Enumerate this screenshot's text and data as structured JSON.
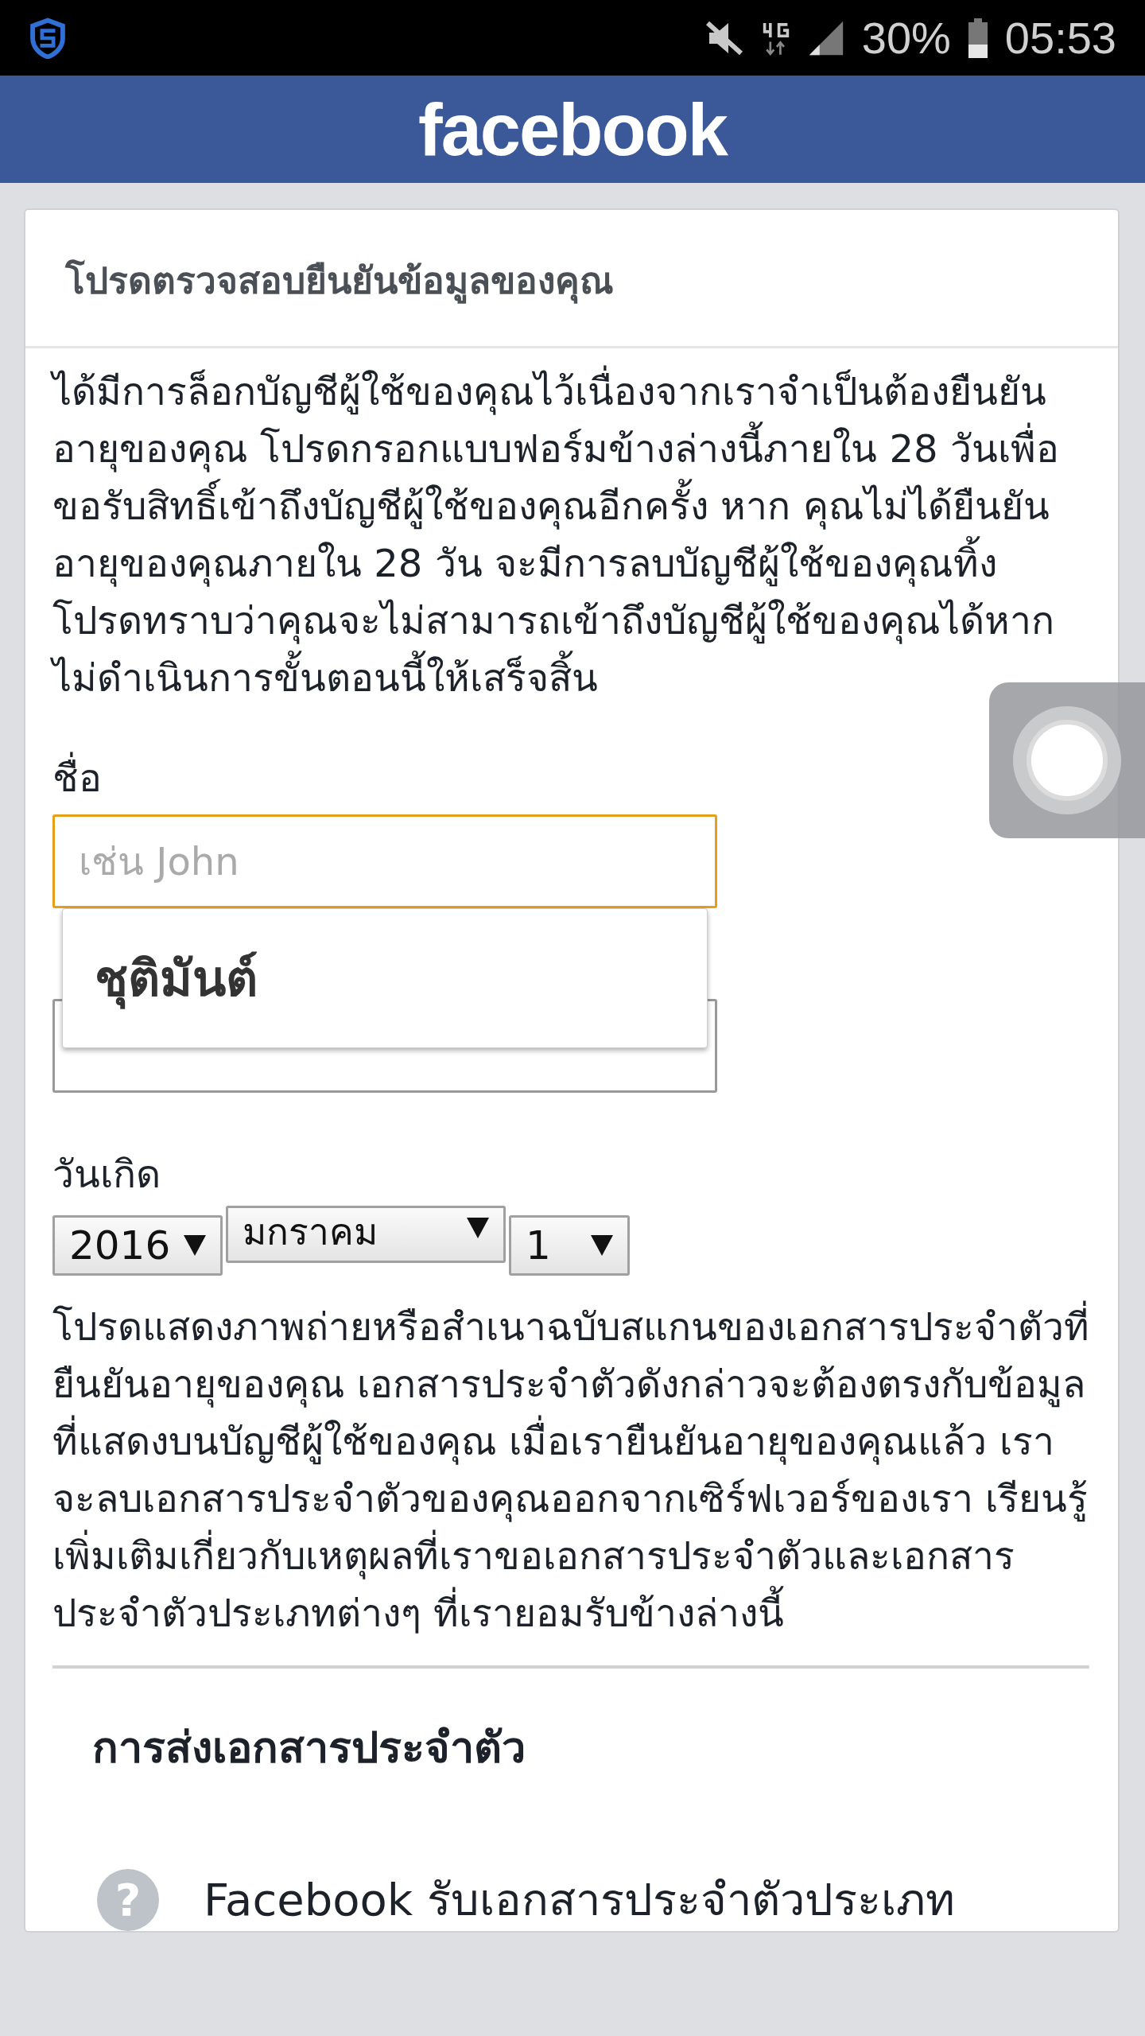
{
  "status_bar": {
    "battery": "30%",
    "time": "05:53"
  },
  "header": {
    "logo": "facebook"
  },
  "card": {
    "title": "โปรดตรวจสอบยืนยันข้อมูลของคุณ",
    "intro": "ได้มีการล็อกบัญชีผู้ใช้ของคุณไว้เนื่องจากเราจำเป็นต้องยืนยันอายุของคุณ โปรดกรอกแบบฟอร์มข้างล่างนี้ภายใน 28 วันเพื่อขอรับสิทธิ์เข้าถึงบัญชีผู้ใช้ของคุณอีกครั้ง หาก คุณไม่ได้ยืนยันอายุของคุณภายใน 28 วัน จะมีการลบบัญชีผู้ใช้ของคุณทิ้ง โปรดทราบว่าคุณจะไม่สามารถเข้าถึงบัญชีผู้ใช้ของคุณได้หากไม่ดำเนินการขั้นตอนนี้ให้เสร็จสิ้น",
    "first_name": {
      "label": "ชื่อ",
      "placeholder": "เช่น John",
      "focused": true
    },
    "autocomplete": {
      "suggestion": "ชุติมันต์"
    },
    "birthday": {
      "label": "วันเกิด",
      "year": "2016",
      "month": "มกราคม",
      "day": "1"
    },
    "id_info": "โปรดแสดงภาพถ่ายหรือสำเนาฉบับสแกนของเอกสารประจำตัวที่ยืนยันอายุของคุณ เอกสารประจำตัวดังกล่าวจะต้องตรงกับข้อมูลที่แสดงบนบัญชีผู้ใช้ของคุณ เมื่อเรายืนยันอายุของคุณแล้ว เราจะลบเอกสารประจำตัวของคุณออกจากเซิร์ฟเวอร์ของเรา เรียนรู้เพิ่มเติมเกี่ยวกับเหตุผลที่เราขอเอกสารประจำตัวและเอกสารประจำตัวประเภทต่างๆ ที่เรายอมรับข้างล่างนี้",
    "section": {
      "title": "การส่งเอกสารประจำตัว",
      "items": [
        {
          "icon": "?",
          "text": "Facebook รับเอกสารประจำตัวประเภท"
        }
      ]
    }
  }
}
